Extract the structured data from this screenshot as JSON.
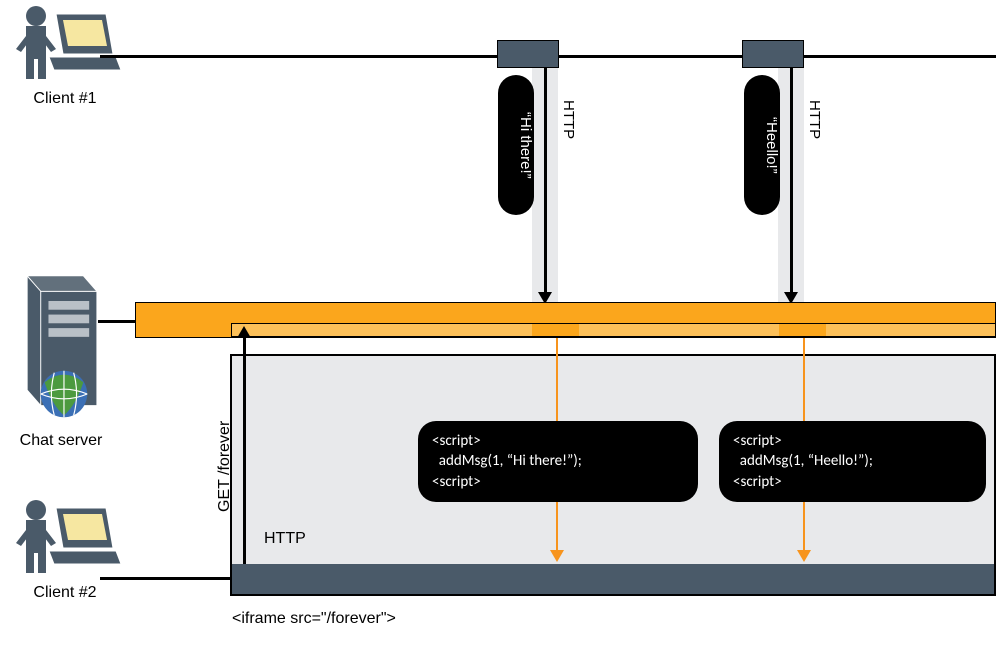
{
  "labels": {
    "client1": "Client #1",
    "client2": "Client #2",
    "server": "Chat server",
    "iframe": "<iframe src=\"/forever\">",
    "get": "GET /forever",
    "http_in_frame": "HTTP",
    "http_v1": "HTTP",
    "http_v2": "HTTP"
  },
  "pills": {
    "msg1": "“Hi there!”",
    "msg2": "“Heello!”"
  },
  "scripts": {
    "s1_open": "<script>",
    "s1_body": "  addMsg(1, “Hi there!”);",
    "s1_close": "<script>",
    "s2_open": "<script>",
    "s2_body": "  addMsg(1, “Heello!”);",
    "s2_close": "<script>"
  }
}
